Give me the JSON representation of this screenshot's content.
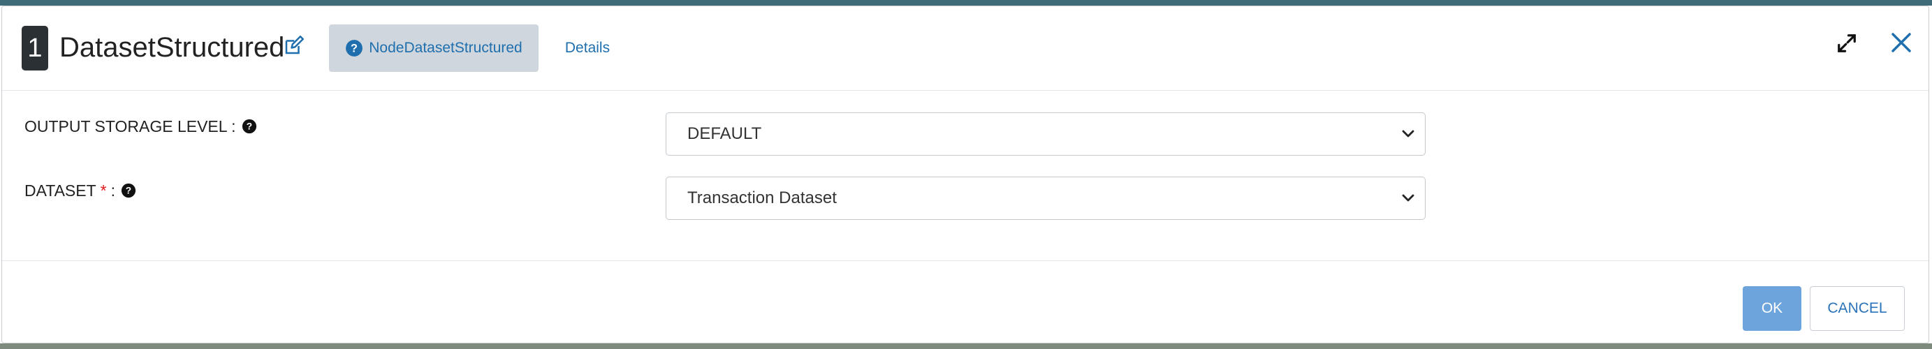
{
  "dialog": {
    "step_number": "1",
    "title": "DatasetStructured",
    "tabs": [
      {
        "label": "NodeDatasetStructured",
        "active": true
      },
      {
        "label": "Details",
        "active": false
      }
    ]
  },
  "form": {
    "fields": [
      {
        "label": "OUTPUT STORAGE LEVEL :",
        "required": false,
        "value": "DEFAULT"
      },
      {
        "label": "DATASET",
        "required": true,
        "required_mark": "*",
        "suffix": ":",
        "value": "Transaction Dataset"
      }
    ]
  },
  "footer": {
    "ok_label": "OK",
    "cancel_label": "CANCEL"
  },
  "colors": {
    "accent": "#1f6fae",
    "ok_button": "#6ea4dc",
    "required": "#e0191f",
    "active_tab_bg": "#cfd6dd"
  },
  "icons": [
    "edit-icon",
    "question-circle-icon",
    "expand-icon",
    "close-icon",
    "chevron-down-icon"
  ]
}
